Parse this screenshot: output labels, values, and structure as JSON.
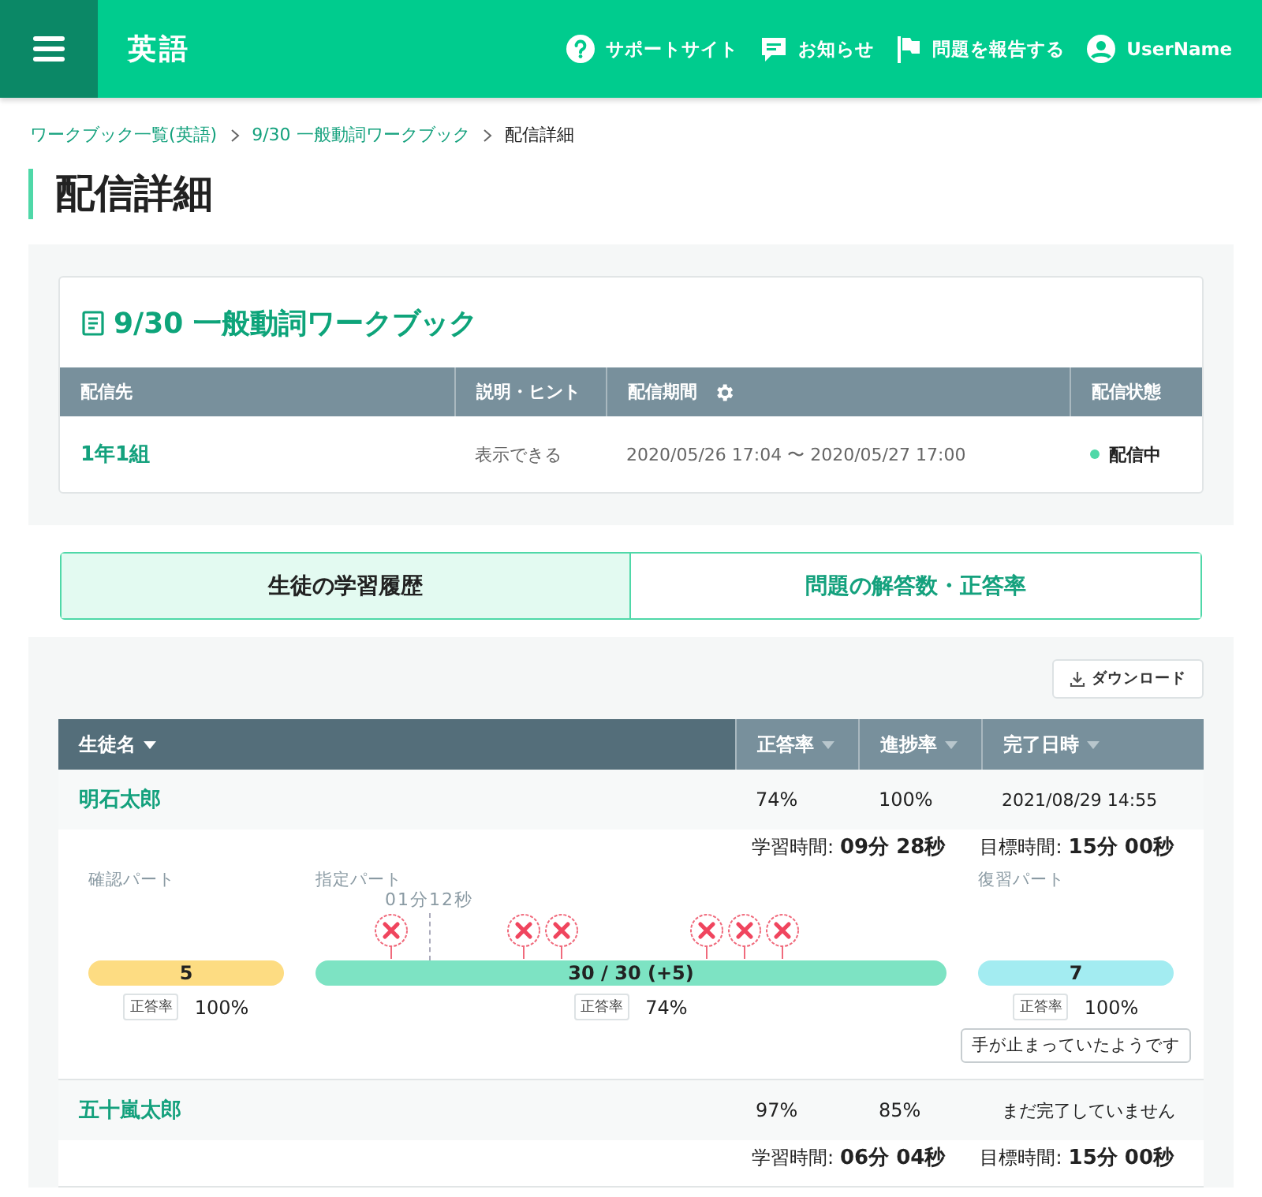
{
  "header": {
    "subject": "英語",
    "links": [
      {
        "kind": "help",
        "label": "サポートサイト"
      },
      {
        "kind": "news",
        "label": "お知らせ"
      },
      {
        "kind": "flag",
        "label": "問題を報告する"
      },
      {
        "kind": "user",
        "label": "UserName"
      }
    ]
  },
  "breadcrumb": [
    {
      "label": "ワークブック一覧(英語)",
      "link": true
    },
    {
      "label": "9/30 一般動詞ワークブック",
      "link": true
    },
    {
      "label": "配信詳細",
      "link": false
    }
  ],
  "page_title": "配信詳細",
  "workbook": {
    "title": "9/30 一般動詞ワークブック",
    "columns": [
      {
        "label": "配信先",
        "settings": false
      },
      {
        "label": "説明・ヒント",
        "settings": false
      },
      {
        "label": "配信期間",
        "settings": true
      },
      {
        "label": "配信状態",
        "settings": false
      }
    ],
    "row": {
      "target": "1年1組",
      "hint": "表示できる",
      "period": "2020/05/26 17:04 〜 2020/05/27 17:00",
      "status": "配信中"
    }
  },
  "tabs": [
    {
      "label": "生徒の学習履歴",
      "selected": true
    },
    {
      "label": "問題の解答数・正答率",
      "selected": false
    }
  ],
  "download": "ダウンロード",
  "students_table": {
    "columns": [
      {
        "label": "生徒名",
        "sorted": true
      },
      {
        "label": "正答率",
        "sorted": false
      },
      {
        "label": "進捗率",
        "sorted": false
      },
      {
        "label": "完了日時",
        "sorted": false
      }
    ],
    "rows": [
      {
        "name": "明石太郎",
        "rate": "74%",
        "progress": "100%",
        "completed": "2021/08/29 14:55",
        "detail": {
          "study_label": "学習時間:",
          "study_time": "09分 28秒",
          "target_label": "目標時間:",
          "target_time": "15分 00秒",
          "parts": [
            {
              "kind": "check",
              "label": "確認パート",
              "count": "5",
              "rate_label": "正答率",
              "rate": "100%"
            },
            {
              "kind": "main",
              "label": "指定パート",
              "count": "30 / 30 (+5)",
              "rate_label": "正答率",
              "rate": "74%",
              "pause": {
                "label": "01分12秒",
                "level": 0.18
              },
              "mistakes": [
                {
                  "level": 0.12
                },
                {
                  "level": 0.33
                },
                {
                  "level": 0.39
                },
                {
                  "level": 0.62
                },
                {
                  "level": 0.68
                },
                {
                  "level": 0.74
                }
              ]
            },
            {
              "kind": "review",
              "label": "復習パート",
              "count": "7",
              "rate_label": "正答率",
              "rate": "100%",
              "note": "手が止まっていたようです"
            }
          ]
        }
      },
      {
        "name": "五十嵐太郎",
        "rate": "97%",
        "progress": "85%",
        "completed": "まだ完了していません",
        "detail": {
          "study_label": "学習時間:",
          "study_time": "06分 04秒",
          "target_label": "目標時間:",
          "target_time": "15分 00秒"
        }
      }
    ]
  }
}
